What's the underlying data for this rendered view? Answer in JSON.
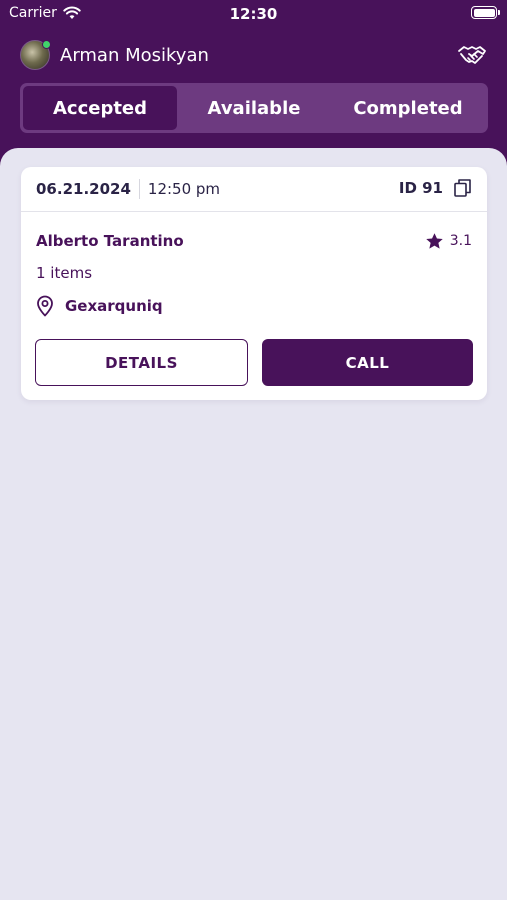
{
  "status_bar": {
    "carrier": "Carrier",
    "time": "12:30"
  },
  "header": {
    "user_name": "Arman Mosikyan",
    "online_color": "#41d36a",
    "brand_color": "#48125a"
  },
  "tabs": [
    {
      "label": "Accepted",
      "active": true
    },
    {
      "label": "Available",
      "active": false
    },
    {
      "label": "Completed",
      "active": false
    }
  ],
  "order": {
    "date": "06.21.2024",
    "time": "12:50 pm",
    "id_label": "ID 91",
    "customer_name": "Alberto Tarantino",
    "rating": "3.1",
    "items": "1 items",
    "location": "Gexarquniq",
    "details_label": "DETAILS",
    "call_label": "CALL"
  }
}
